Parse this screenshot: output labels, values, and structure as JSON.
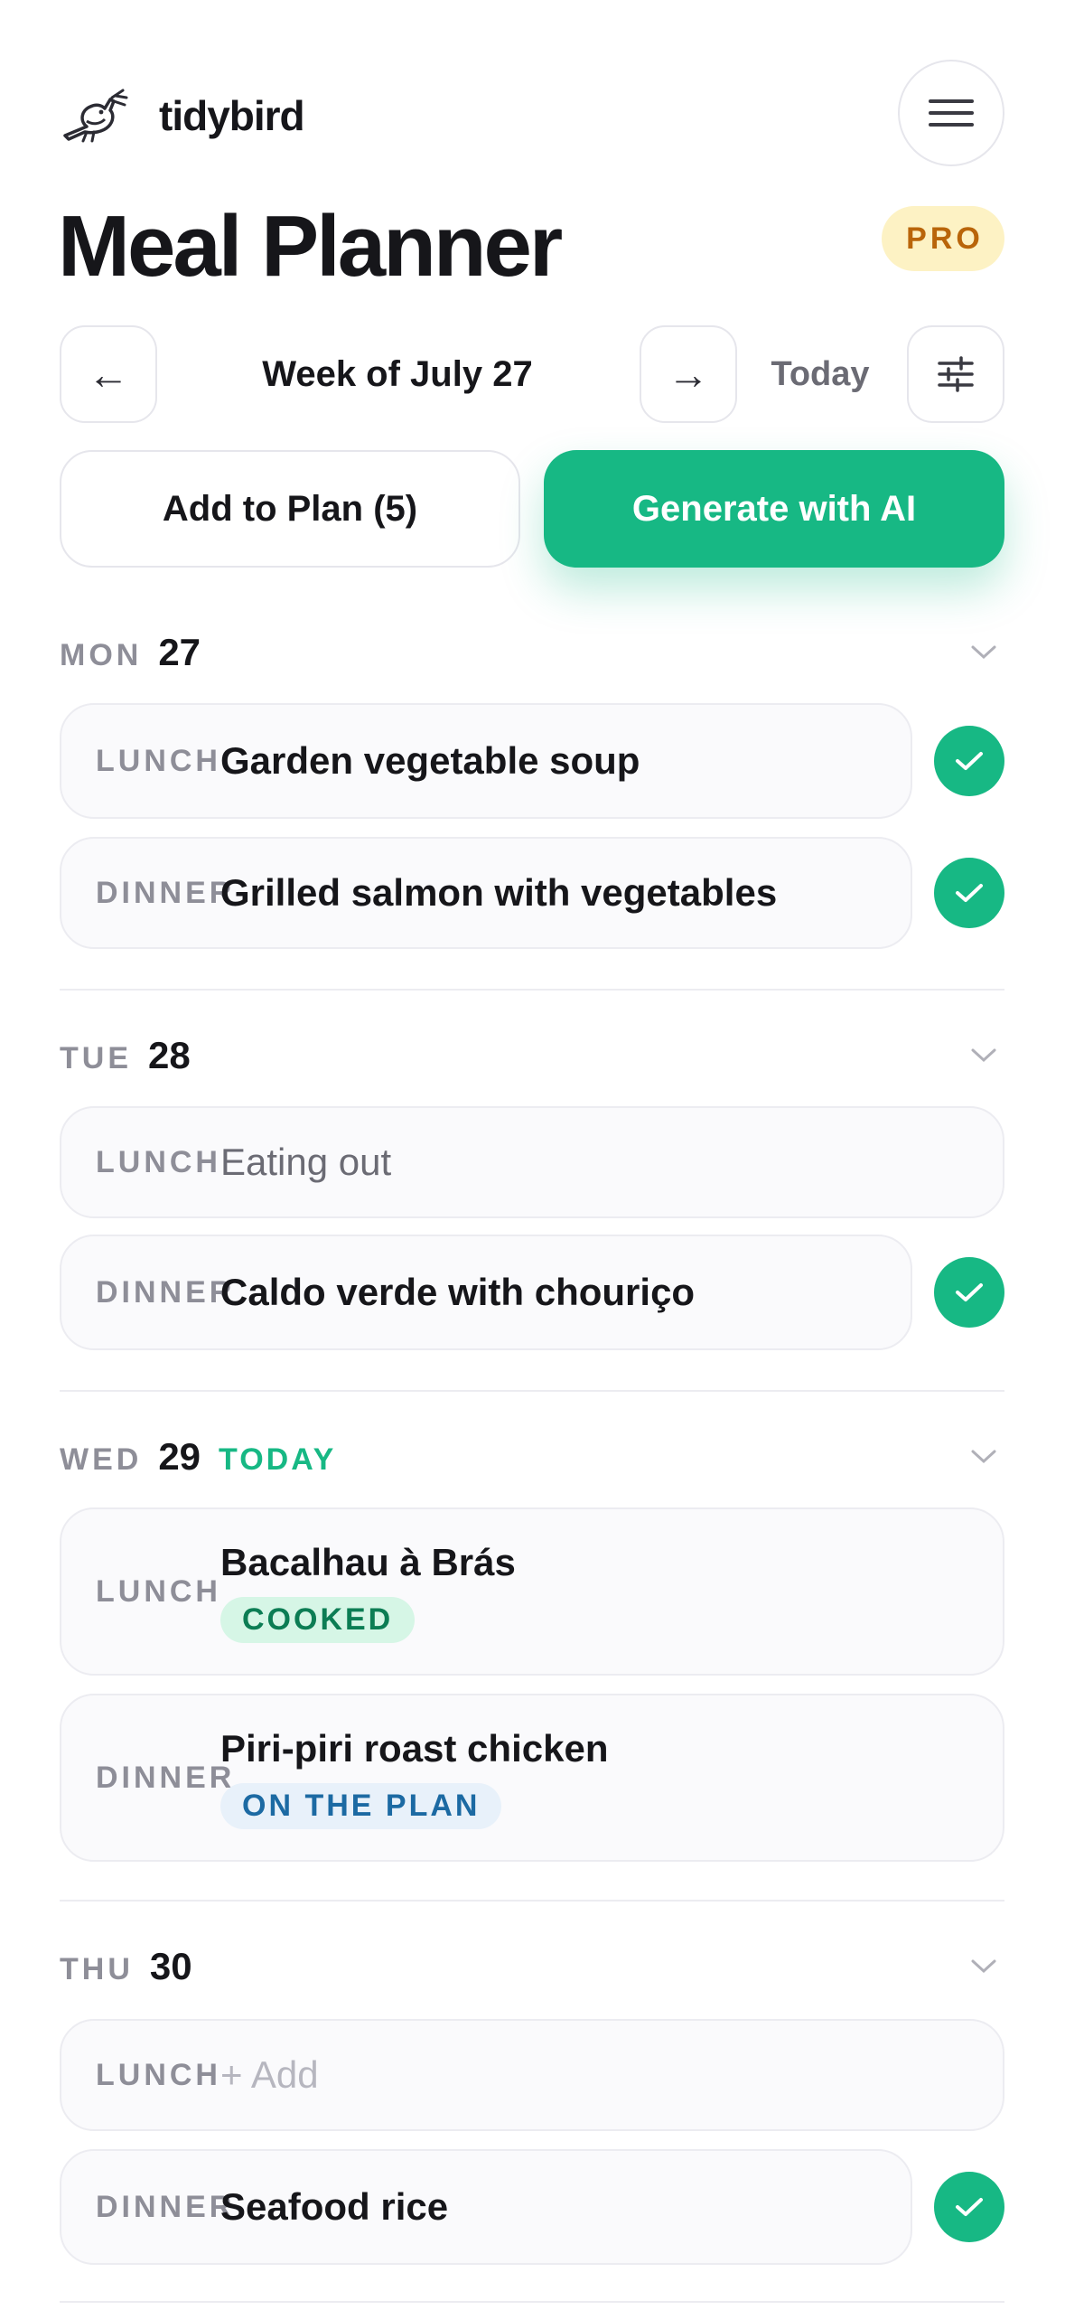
{
  "app": {
    "name": "tidybird"
  },
  "header": {
    "title": "Meal Planner",
    "badge": "PRO"
  },
  "week_nav": {
    "prev": "←",
    "label": "Week of July 27",
    "next": "→",
    "today": "Today"
  },
  "actions": {
    "add_to_plan": "Add to Plan (5)",
    "generate": "Generate with AI"
  },
  "days": [
    {
      "name": "MON",
      "num": "27",
      "meals": [
        {
          "label": "LUNCH",
          "title": "Garden vegetable soup",
          "done": true
        },
        {
          "label": "DINNER",
          "title": "Grilled salmon with vegetables",
          "done": true
        }
      ]
    },
    {
      "name": "TUE",
      "num": "28",
      "meals": [
        {
          "label": "LUNCH",
          "title": "Eating out",
          "done": false
        },
        {
          "label": "DINNER",
          "title": "Caldo verde with chouriço",
          "done": true
        }
      ]
    },
    {
      "name": "WED",
      "num": "29",
      "today_tag": "TODAY",
      "meals": [
        {
          "label": "LUNCH",
          "title": "Bacalhau à Brás",
          "tag": "COOKED"
        },
        {
          "label": "DINNER",
          "title": "Piri-piri roast chicken",
          "tag": "ON THE PLAN"
        }
      ]
    },
    {
      "name": "THU",
      "num": "30",
      "meals": [
        {
          "label": "LUNCH",
          "title": "+ Add"
        },
        {
          "label": "DINNER",
          "title": "Seafood rice",
          "done": true
        }
      ]
    }
  ],
  "colors": {
    "accent": "#17b884",
    "pro_bg": "#fdf2c4",
    "pro_text": "#b9650a"
  },
  "icons": [
    "bird-logo-icon",
    "hamburger-menu-icon",
    "arrow-left-icon",
    "arrow-right-icon",
    "sliders-icon",
    "chevron-down-icon",
    "check-icon"
  ]
}
